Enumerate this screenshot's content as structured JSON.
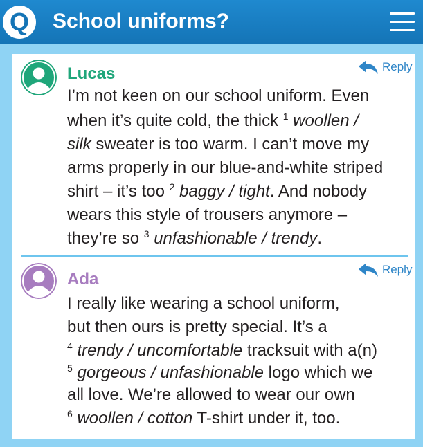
{
  "header": {
    "badge": "Q",
    "title": "School uniforms?"
  },
  "colors": {
    "header_blue": "#1474b6",
    "panel_blue": "#8fd3f4",
    "lucas_green": "#1fa67a",
    "ada_purple": "#a77cbf",
    "reply_blue": "#2f86c8"
  },
  "icons": {
    "menu": "hamburger-menu-icon",
    "reply": "reply-arrow-icon",
    "avatar": "user-avatar-icon"
  },
  "posts": [
    {
      "author": "Lucas",
      "reply_label": "Reply",
      "lines": [
        [
          {
            "t": "I’m not keen on our school uniform. Even"
          }
        ],
        [
          {
            "t": "when it’s quite cold, the thick "
          },
          {
            "sup": "1"
          },
          {
            "t": " "
          },
          {
            "i": "woollen /"
          }
        ],
        [
          {
            "i": "silk"
          },
          {
            "t": " sweater is too warm. I can’t move my"
          }
        ],
        [
          {
            "t": "arms properly in our blue-and-white striped"
          }
        ],
        [
          {
            "t": "shirt – it’s too "
          },
          {
            "sup": "2"
          },
          {
            "t": " "
          },
          {
            "i": "baggy / tight"
          },
          {
            "t": ". And nobody"
          }
        ],
        [
          {
            "t": "wears this style of trousers anymore –"
          }
        ],
        [
          {
            "t": "they’re so "
          },
          {
            "sup": "3"
          },
          {
            "t": " "
          },
          {
            "i": "unfashionable / trendy"
          },
          {
            "t": "."
          }
        ]
      ]
    },
    {
      "author": "Ada",
      "reply_label": "Reply",
      "lines": [
        [
          {
            "t": "I really like wearing a school uniform,"
          }
        ],
        [
          {
            "t": "but then ours is pretty special. It’s a"
          }
        ],
        [
          {
            "sup": "4"
          },
          {
            "t": " "
          },
          {
            "i": "trendy / uncomfortable"
          },
          {
            "t": " tracksuit with a(n)"
          }
        ],
        [
          {
            "sup": "5"
          },
          {
            "t": " "
          },
          {
            "i": "gorgeous / unfashionable"
          },
          {
            "t": " logo which we"
          }
        ],
        [
          {
            "t": "all love. We’re allowed to wear our own"
          }
        ],
        [
          {
            "sup": "6"
          },
          {
            "t": " "
          },
          {
            "i": "woollen / cotton"
          },
          {
            "t": " T-shirt under it, too."
          }
        ]
      ]
    }
  ]
}
